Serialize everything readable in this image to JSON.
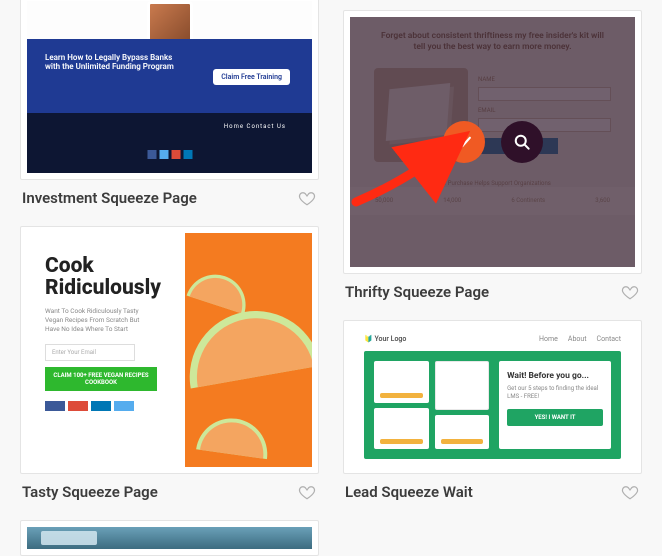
{
  "templates": {
    "investment": {
      "title": "Investment Squeeze Page",
      "hero_line1": "Learn How to Legally Bypass Banks",
      "hero_line2": "with the Unlimited Funding Program",
      "cta": "Claim Free Training",
      "menu": "Home   Contact Us"
    },
    "tasty": {
      "title": "Tasty Squeeze Page",
      "heading1": "Cook",
      "heading2": "Ridiculously",
      "sub": "Want To Cook Ridiculously Tasty Vegan Recipes From Scratch But Have No Idea Where To Start",
      "placeholder": "Enter Your Email",
      "button": "CLAIM 100+ FREE VEGAN RECIPES COOKBOOK"
    },
    "thrifty": {
      "title": "Thrifty Squeeze Page",
      "hero": "Forget about consistent thriftiness my free insider's kit will tell you the best way to earn more money.",
      "trust": "Your Purchase Helps Support Organizations",
      "footer_items": [
        "50,000",
        "14,000",
        "6 Continents",
        "3,600"
      ]
    },
    "lead": {
      "title": "Lead Squeeze Wait",
      "logo": "Your Logo",
      "nav": [
        "Home",
        "About",
        "Contact"
      ],
      "panel_heading": "Wait! Before you go...",
      "panel_sub": "Get our 5 steps to finding the ideal LMS - FREE!",
      "panel_cta": "YES! I WANT IT"
    }
  }
}
